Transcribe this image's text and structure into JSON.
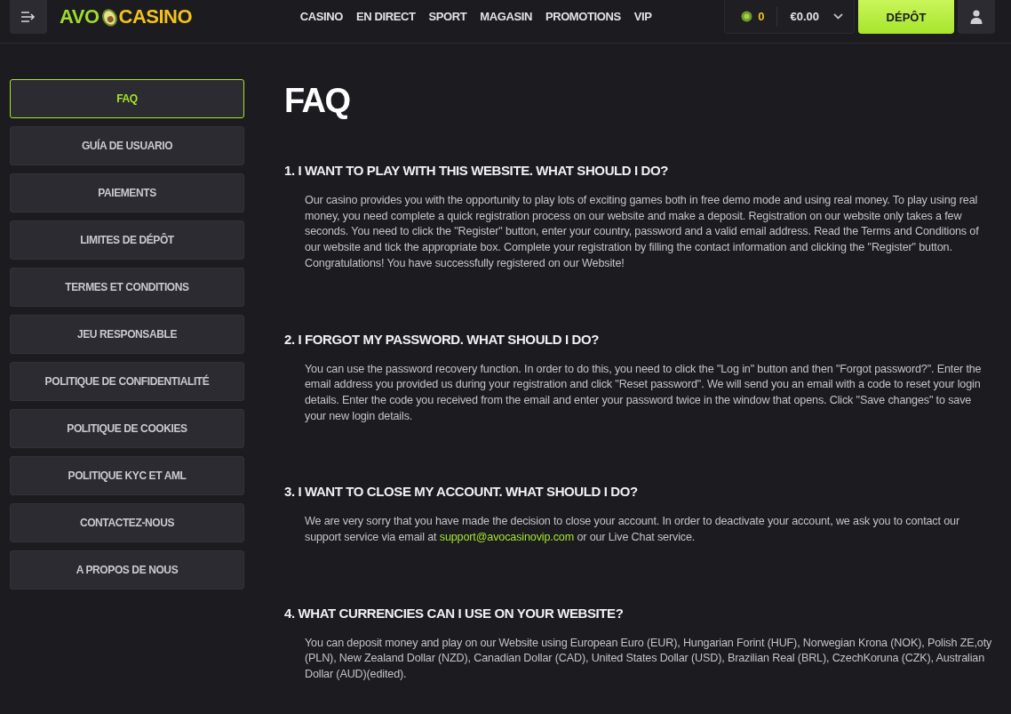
{
  "header": {
    "logo": {
      "left": "AVO",
      "right": "CASINO"
    },
    "nav": [
      "CASINO",
      "EN DIRECT",
      "SPORT",
      "MAGASIN",
      "PROMOTIONS",
      "VIP"
    ],
    "coins": "0",
    "balance": "€0.00",
    "deposit_button": "DÉPÔT"
  },
  "sidebar": {
    "items": [
      {
        "label": "FAQ",
        "selected": true
      },
      {
        "label": "GUÍA DE USUARIO",
        "selected": false
      },
      {
        "label": "PAIEMENTS",
        "selected": false
      },
      {
        "label": "LIMITES DE DÉPÔT",
        "selected": false
      },
      {
        "label": "TERMES ET CONDITIONS",
        "selected": false
      },
      {
        "label": "JEU RESPONSABLE",
        "selected": false
      },
      {
        "label": "POLITIQUE DE CONFIDENTIALITÉ",
        "selected": false
      },
      {
        "label": "POLITIQUE DE COOKIES",
        "selected": false
      },
      {
        "label": "POLITIQUE KYC ET AML",
        "selected": false
      },
      {
        "label": "CONTACTEZ-NOUS",
        "selected": false
      },
      {
        "label": "A PROPOS DE NOUS",
        "selected": false
      }
    ]
  },
  "page": {
    "title": "FAQ",
    "questions": [
      {
        "question": "1. I WANT TO PLAY WITH THIS WEBSITE. WHAT SHOULD I DO?",
        "answer": [
          {
            "kind": "text",
            "text": "Our casino provides you with the opportunity to play lots of exciting games both in free demo mode and using real money. To play using real money, you need complete a quick registration process on our website and make a deposit. Registration on our website only takes a few seconds. You need to click the \"Register\" button, enter your country, password and a valid email address. Read the Terms and Conditions of our website and tick the appropriate box. Complete your registration by filling the contact information and clicking the \"Register\" button. Congratulations! You have successfully registered on our Website!"
          }
        ]
      },
      {
        "question": "2. I FORGOT MY PASSWORD. WHAT SHOULD I DO?",
        "answer": [
          {
            "kind": "text",
            "text": "You can use the password recovery function. In order to do this, you need to click the \"Log in\" button and then \"Forgot password?\". Enter the email address you provided us during your registration and click \"Reset password\". We will send you an email with a code to reset your login details. Enter the code you received from the email and enter your password twice in the window that opens. Click \"Save changes\" to save your new login details."
          }
        ]
      },
      {
        "question": "3. I WANT TO CLOSE MY ACCOUNT. WHAT SHOULD I DO?",
        "answer": [
          {
            "kind": "text",
            "text": "We are very sorry that you have made the decision to close your account. In order to deactivate your account, we ask you to contact our support service via email at "
          },
          {
            "kind": "link",
            "text": "support@avocasinovip.com"
          },
          {
            "kind": "text",
            "text": " or our Live Chat service."
          }
        ]
      },
      {
        "question": "4. WHAT CURRENCIES CAN I USE ON YOUR WEBSITE?",
        "answer": [
          {
            "kind": "text",
            "text": "You can deposit money and play on our Website using European Euro (EUR), Hungarian Forint (HUF), Norwegian Krona (NOK), Polish ZE,oty (PLN), New Zealand Dollar (NZD), Canadian Dollar (CAD), United States Dollar (USD), Brazilian Real (BRL), CzechKoruna (CZK), Australian Dollar (AUD)(edited)."
          }
        ]
      }
    ]
  }
}
